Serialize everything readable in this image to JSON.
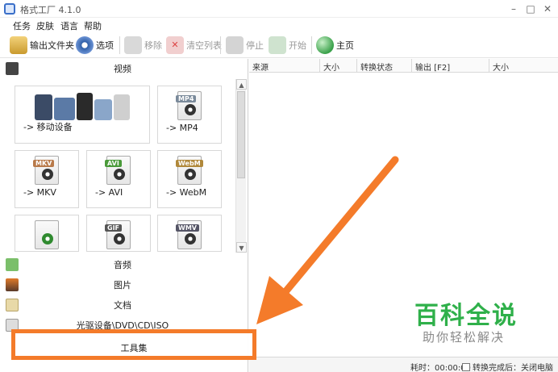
{
  "window": {
    "title": "格式工厂 4.1.0"
  },
  "menu": {
    "items": [
      "任务",
      "皮肤",
      "语言",
      "帮助"
    ]
  },
  "toolbar": {
    "output_folder": "输出文件夹",
    "options": "选项",
    "remove": "移除",
    "clear_list": "清空列表",
    "stop": "停止",
    "start": "开始",
    "home": "主页"
  },
  "categories": {
    "video": "视频",
    "audio": "音频",
    "image": "图片",
    "document": "文档",
    "disc": "光驱设备\\DVD\\CD\\ISO",
    "tools": "工具集"
  },
  "tiles": {
    "mobile": "-> 移动设备",
    "mp4": "-> MP4",
    "mkv": "-> MKV",
    "avi": "-> AVI",
    "webm": "-> WebM"
  },
  "tile_badges": {
    "mp4": "MP4",
    "mkv": "MKV",
    "avi": "AVI",
    "webm": "WebM",
    "gif": "GIF",
    "wmv": "WMV"
  },
  "grid": {
    "columns": [
      "来源",
      "大小",
      "转换状态",
      "输出 [F2]",
      "大小"
    ]
  },
  "status": {
    "elapsed": "耗时：00:00:00",
    "after_convert": "转换完成后：关闭电脑"
  },
  "watermark": {
    "title": "百科全说",
    "subtitle": "助你轻松解决"
  },
  "colors": {
    "accent_orange": "#f47b2a",
    "watermark_green": "#2fb04a"
  }
}
